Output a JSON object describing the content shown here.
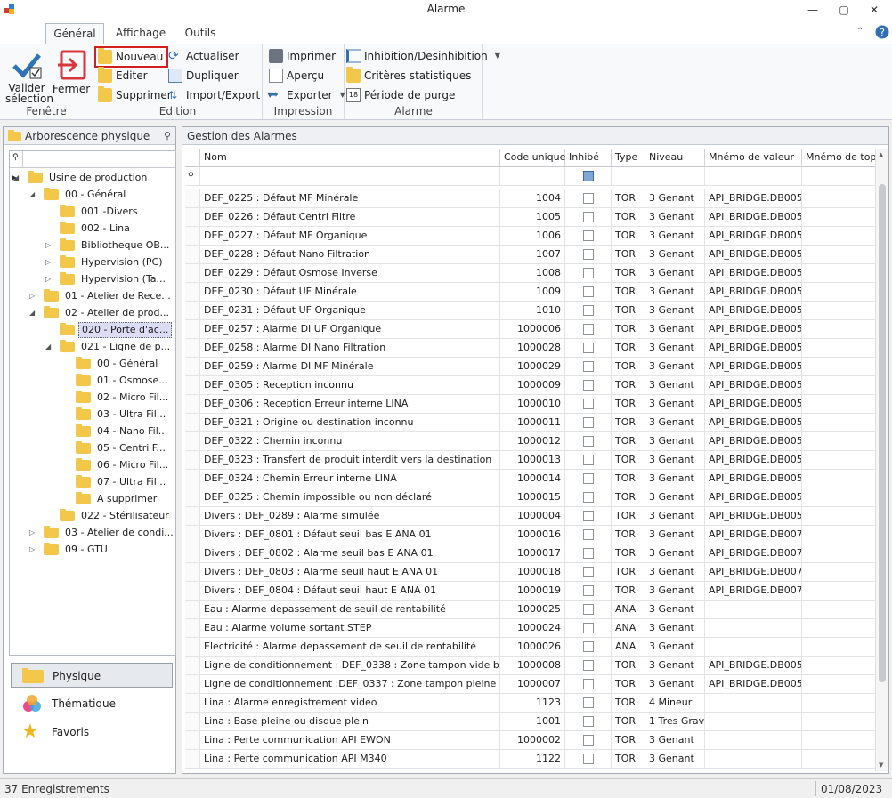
{
  "window": {
    "title": "Alarme",
    "minimize": "—",
    "maximize": "▢",
    "close": "✕"
  },
  "ribbon_tabs": [
    "Général",
    "Affichage",
    "Outils"
  ],
  "ribbon": {
    "fenetre": {
      "label": "Fenêtre",
      "valider": "Valider sélection",
      "fermer": "Fermer"
    },
    "edition": {
      "label": "Edition",
      "nouveau": "Nouveau",
      "editer": "Editer",
      "supprimer": "Supprimer",
      "actualiser": "Actualiser",
      "dupliquer": "Dupliquer",
      "import_export": "Import/Export"
    },
    "impression": {
      "label": "Impression",
      "imprimer": "Imprimer",
      "apercu": "Aperçu",
      "exporter": "Exporter"
    },
    "alarme": {
      "label": "Alarme",
      "inhibition": "Inhibition/Desinhibition",
      "criteres": "Critères statistiques",
      "purge": "Période de purge"
    }
  },
  "left_panel": {
    "title": "Arborescence physique",
    "tree": [
      {
        "label": "Usine de production",
        "indent": 1,
        "arrow": "open"
      },
      {
        "label": "00 - Général",
        "indent": 2,
        "arrow": "open"
      },
      {
        "label": "001 -Divers",
        "indent": 3,
        "arrow": "none"
      },
      {
        "label": "002 - Lina",
        "indent": 3,
        "arrow": "none"
      },
      {
        "label": "Bibliotheque OB...",
        "indent": 3,
        "arrow": "closed"
      },
      {
        "label": "Hypervision (PC)",
        "indent": 3,
        "arrow": "closed"
      },
      {
        "label": "Hypervision (Ta...",
        "indent": 3,
        "arrow": "closed"
      },
      {
        "label": "01 - Atelier de Rece...",
        "indent": 2,
        "arrow": "closed"
      },
      {
        "label": "02 - Atelier de prod...",
        "indent": 2,
        "arrow": "open"
      },
      {
        "label": "020 - Porte d'ac...",
        "indent": 3,
        "arrow": "none",
        "selected": true
      },
      {
        "label": "021 - Ligne de p...",
        "indent": 3,
        "arrow": "open"
      },
      {
        "label": "00 - Général",
        "indent": 4,
        "arrow": "none"
      },
      {
        "label": "01 - Osmose...",
        "indent": 4,
        "arrow": "none"
      },
      {
        "label": "02 - Micro Fil...",
        "indent": 4,
        "arrow": "none"
      },
      {
        "label": "03 - Ultra Fil...",
        "indent": 4,
        "arrow": "none"
      },
      {
        "label": "04 - Nano Fil...",
        "indent": 4,
        "arrow": "none"
      },
      {
        "label": "05 - Centri F...",
        "indent": 4,
        "arrow": "none"
      },
      {
        "label": "06 - Micro Fil...",
        "indent": 4,
        "arrow": "none"
      },
      {
        "label": "07 - Ultra Fil...",
        "indent": 4,
        "arrow": "none"
      },
      {
        "label": "A supprimer",
        "indent": 4,
        "arrow": "none"
      },
      {
        "label": "022 - Stérilisateur",
        "indent": 3,
        "arrow": "none"
      },
      {
        "label": "03 - Atelier de condi...",
        "indent": 2,
        "arrow": "closed"
      },
      {
        "label": "09 - GTU",
        "indent": 2,
        "arrow": "closed"
      }
    ],
    "nav": [
      {
        "label": "Physique",
        "icon": "folder-icon",
        "selected": true
      },
      {
        "label": "Thématique",
        "icon": "circles-icon"
      },
      {
        "label": "Favoris",
        "icon": "star-icon"
      }
    ]
  },
  "right_panel": {
    "title": "Gestion des Alarmes",
    "columns": [
      "Nom",
      "Code unique",
      "Inhibé",
      "Type",
      "Niveau",
      "Mnémo de valeur",
      "Mnémo de top"
    ],
    "rows": [
      [
        "DEF_0225 : Défaut MF Minérale",
        "1004",
        "TOR",
        "3 Genant",
        "API_BRIDGE.DB005..."
      ],
      [
        "DEF_0226 : Défaut Centri Filtre",
        "1005",
        "TOR",
        "3 Genant",
        "API_BRIDGE.DB005..."
      ],
      [
        "DEF_0227 : Défaut MF Organique",
        "1006",
        "TOR",
        "3 Genant",
        "API_BRIDGE.DB005..."
      ],
      [
        "DEF_0228 : Défaut Nano Filtration",
        "1007",
        "TOR",
        "3 Genant",
        "API_BRIDGE.DB005..."
      ],
      [
        "DEF_0229 : Défaut Osmose Inverse",
        "1008",
        "TOR",
        "3 Genant",
        "API_BRIDGE.DB005..."
      ],
      [
        "DEF_0230 : Défaut UF Minérale",
        "1009",
        "TOR",
        "3 Genant",
        "API_BRIDGE.DB005..."
      ],
      [
        "DEF_0231 : Défaut UF Organique",
        "1010",
        "TOR",
        "3 Genant",
        "API_BRIDGE.DB005..."
      ],
      [
        "DEF_0257 : Alarme DI UF Organique",
        "1000006",
        "TOR",
        "3 Genant",
        "API_BRIDGE.DB005..."
      ],
      [
        "DEF_0258 : Alarme DI Nano Filtration",
        "1000028",
        "TOR",
        "3 Genant",
        "API_BRIDGE.DB005..."
      ],
      [
        "DEF_0259 : Alarme DI MF Minérale",
        "1000029",
        "TOR",
        "3 Genant",
        "API_BRIDGE.DB005..."
      ],
      [
        "DEF_0305 : Reception inconnu",
        "1000009",
        "TOR",
        "3 Genant",
        "API_BRIDGE.DB005..."
      ],
      [
        "DEF_0306 : Reception Erreur interne LINA",
        "1000010",
        "TOR",
        "3 Genant",
        "API_BRIDGE.DB005..."
      ],
      [
        "DEF_0321 : Origine ou destination inconnu",
        "1000011",
        "TOR",
        "3 Genant",
        "API_BRIDGE.DB005..."
      ],
      [
        "DEF_0322 : Chemin inconnu",
        "1000012",
        "TOR",
        "3 Genant",
        "API_BRIDGE.DB005..."
      ],
      [
        "DEF_0323 : Transfert de produit interdit vers la destination",
        "1000013",
        "TOR",
        "3 Genant",
        "API_BRIDGE.DB005..."
      ],
      [
        "DEF_0324 : Chemin Erreur interne LINA",
        "1000014",
        "TOR",
        "3 Genant",
        "API_BRIDGE.DB005..."
      ],
      [
        "DEF_0325 : Chemin impossible ou non déclaré",
        "1000015",
        "TOR",
        "3 Genant",
        "API_BRIDGE.DB005..."
      ],
      [
        "Divers : DEF_0289 : Alarme simulée",
        "1000004",
        "TOR",
        "3 Genant",
        "API_BRIDGE.DB005..."
      ],
      [
        "Divers : DEF_0801 : Défaut seuil bas E ANA 01",
        "1000016",
        "TOR",
        "3 Genant",
        "API_BRIDGE.DB007..."
      ],
      [
        "Divers : DEF_0802 : Alarme seuil bas E ANA 01",
        "1000017",
        "TOR",
        "3 Genant",
        "API_BRIDGE.DB007..."
      ],
      [
        "Divers : DEF_0803 : Alarme seuil haut E ANA 01",
        "1000018",
        "TOR",
        "3 Genant",
        "API_BRIDGE.DB007..."
      ],
      [
        "Divers : DEF_0804 : Défaut seuil haut E ANA 01",
        "1000019",
        "TOR",
        "3 Genant",
        "API_BRIDGE.DB007..."
      ],
      [
        "Eau : Alarme depassement de seuil de rentabilité",
        "1000025",
        "ANA",
        "3 Genant",
        ""
      ],
      [
        "Eau : Alarme volume sortant STEP",
        "1000024",
        "ANA",
        "3 Genant",
        ""
      ],
      [
        "Electricité : Alarme depassement de seuil de rentabilité",
        "1000026",
        "ANA",
        "3 Genant",
        ""
      ],
      [
        "Ligne de conditionnement : DEF_0338 : Zone tampon vide balance",
        "1000008",
        "TOR",
        "3 Genant",
        "API_BRIDGE.DB005..."
      ],
      [
        "Ligne de conditionnement :DEF_0337 : Zone tampon pleine balance",
        "1000007",
        "TOR",
        "3 Genant",
        "API_BRIDGE.DB005..."
      ],
      [
        "Lina : Alarme enregistrement video",
        "1123",
        "TOR",
        "4 Mineur",
        ""
      ],
      [
        "Lina : Base pleine ou disque plein",
        "1001",
        "TOR",
        "1 Tres Grav",
        ""
      ],
      [
        "Lina : Perte communication API EWON",
        "1000002",
        "TOR",
        "3 Genant",
        ""
      ],
      [
        "Lina : Perte communication API M340",
        "1122",
        "TOR",
        "3 Genant",
        ""
      ]
    ]
  },
  "status": {
    "count": "37 Enregistrements",
    "date": "01/08/2023"
  }
}
